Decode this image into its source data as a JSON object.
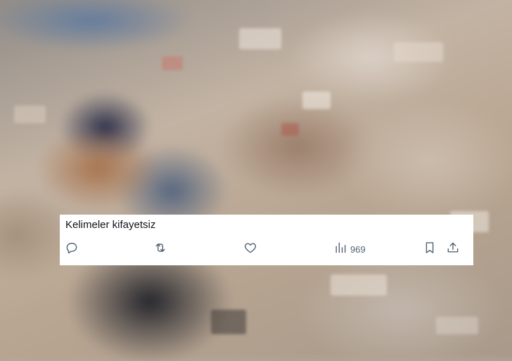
{
  "tweet": {
    "text": "Kelimeler kifayetsiz",
    "views_count": "969"
  },
  "actions": {
    "reply_icon": "reply-icon",
    "retweet_icon": "retweet-icon",
    "like_icon": "heart-icon",
    "views_icon": "analytics-icon",
    "bookmark_icon": "bookmark-icon",
    "share_icon": "share-icon"
  },
  "colors": {
    "card_background": "#ffffff",
    "text": "#0f1419",
    "icon": "#536471"
  }
}
